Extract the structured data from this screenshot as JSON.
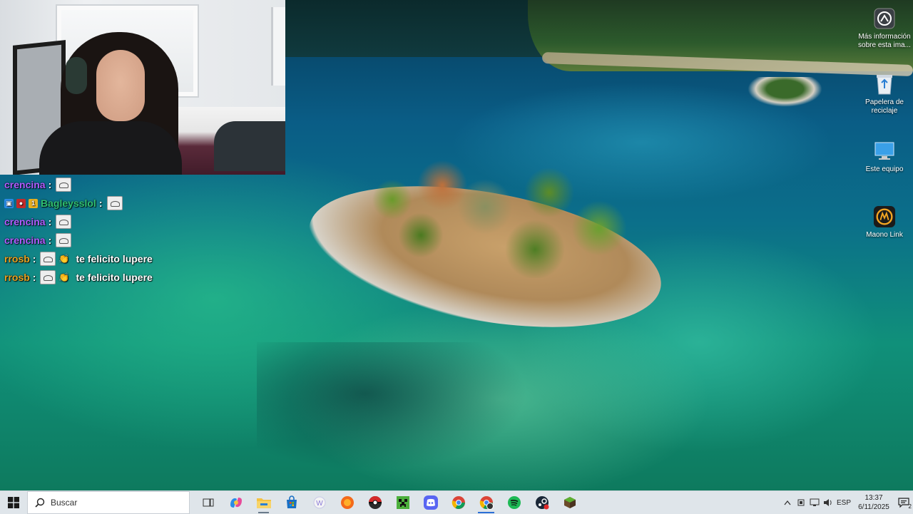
{
  "wallpaper_info": {
    "label": "Más información sobre esta ima..."
  },
  "desktop_icons": [
    {
      "label": "Papelera de reciclaje",
      "icon": "recycle-bin-icon"
    },
    {
      "label": "Este equipo",
      "icon": "computer-icon"
    },
    {
      "label": "Maono Link",
      "icon": "maono-link-icon"
    }
  ],
  "chat": [
    {
      "user": "crencina",
      "color": "#b05cff",
      "badges": [],
      "message": "",
      "emotes": [
        "emote"
      ]
    },
    {
      "user": "Bagleysslol",
      "color": "#2fbf71",
      "badges": [
        "prime-badge",
        "red-badge",
        "gold-badge"
      ],
      "message": "",
      "emotes": [
        "emote"
      ]
    },
    {
      "user": "crencina",
      "color": "#b05cff",
      "badges": [],
      "message": "",
      "emotes": [
        "emote"
      ]
    },
    {
      "user": "crencina",
      "color": "#b05cff",
      "badges": [],
      "message": "",
      "emotes": [
        "emote"
      ]
    },
    {
      "user": "rrosb",
      "color": "#e8a020",
      "badges": [],
      "message": "te felicito lupere",
      "emotes": [
        "emote",
        "clap"
      ]
    },
    {
      "user": "rrosb",
      "color": "#e8a020",
      "badges": [],
      "message": "te felicito lupere",
      "emotes": [
        "emote",
        "clap"
      ]
    }
  ],
  "taskbar": {
    "search_placeholder": "Buscar",
    "apps": [
      "task-view-icon",
      "copilot-icon",
      "file-explorer-icon",
      "store-icon",
      "word-icon",
      "orange-app-icon",
      "pokeball-app-icon",
      "minecraft-icon",
      "discord-icon",
      "chrome-icon",
      "chrome-profile-icon",
      "spotify-icon",
      "steam-icon",
      "minecraft-launcher-icon"
    ],
    "tray": {
      "language": "ESP",
      "time": "13:37",
      "date": "6/11/2025",
      "notifications": "2"
    }
  }
}
